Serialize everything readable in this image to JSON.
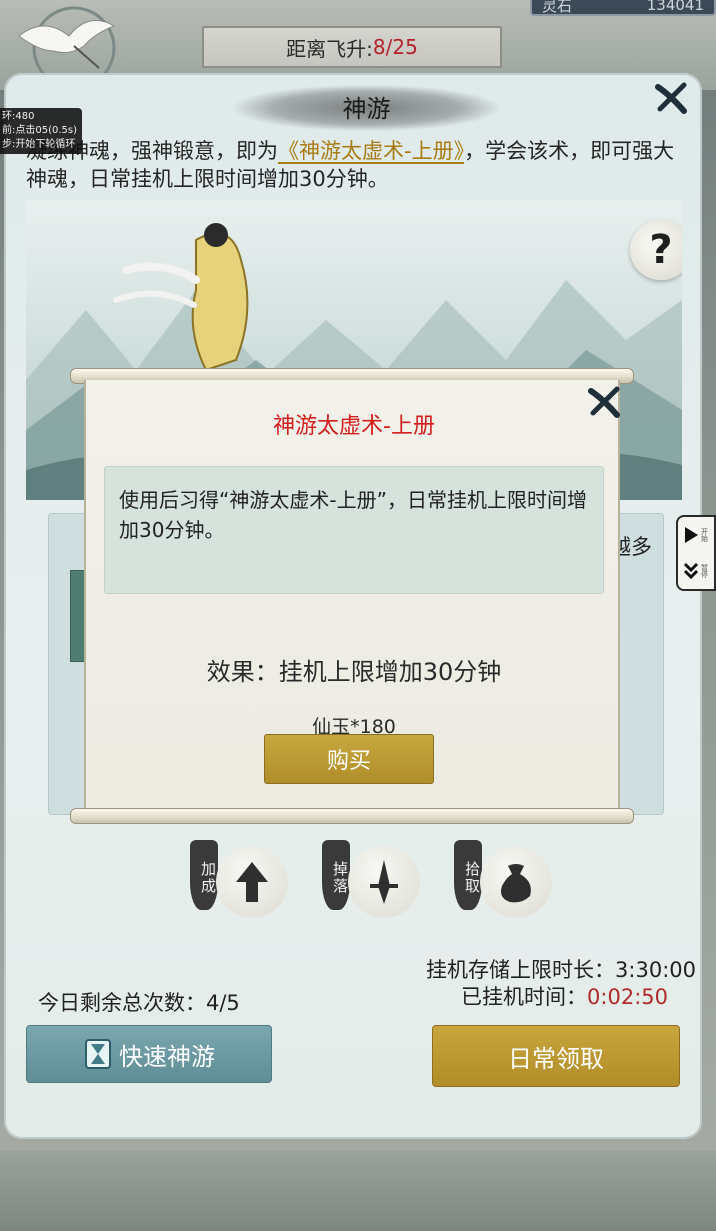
{
  "top_bar": {
    "ascend_label": "距离飞升:",
    "ascend_value": "8/25",
    "resource_label": "灵石",
    "resource_value": "134041"
  },
  "debug": {
    "line1": "环:480",
    "line2": "前:点击05(0.5s)",
    "line3": "步:开始下轮循环"
  },
  "panel": {
    "title": "神游",
    "intro_prefix": "凝练神魂，强神锻意，即为",
    "intro_book": "《神游太虚术-上册》",
    "intro_suffix": "，学会该术，即可强大神魂，日常挂机上限时间增加30分钟。",
    "help": "?",
    "card_right_text": "越多"
  },
  "bonuses": [
    {
      "tag": "加成",
      "icon": "up-arrow-icon"
    },
    {
      "tag": "掉落",
      "icon": "sword-icon"
    },
    {
      "tag": "拾取",
      "icon": "pouch-icon"
    }
  ],
  "idle": {
    "limit_label": "挂机存储上限时长：",
    "limit_value": "3:30:00",
    "elapsed_label": "已挂机时间：",
    "elapsed_value": "0:02:50",
    "remain_label": "今日剩余总次数：",
    "remain_value": "4/5"
  },
  "buttons": {
    "quick": "快速神游",
    "daily": "日常领取"
  },
  "side_tab": {
    "play_small": "开始",
    "pause_small": "暂停"
  },
  "dialog": {
    "title": "神游太虚术-上册",
    "description": "使用后习得“神游太虚术-上册”，日常挂机上限时间增加30分钟。",
    "effect": "效果：挂机上限增加30分钟",
    "price": "仙玉*180",
    "buy": "购买"
  }
}
